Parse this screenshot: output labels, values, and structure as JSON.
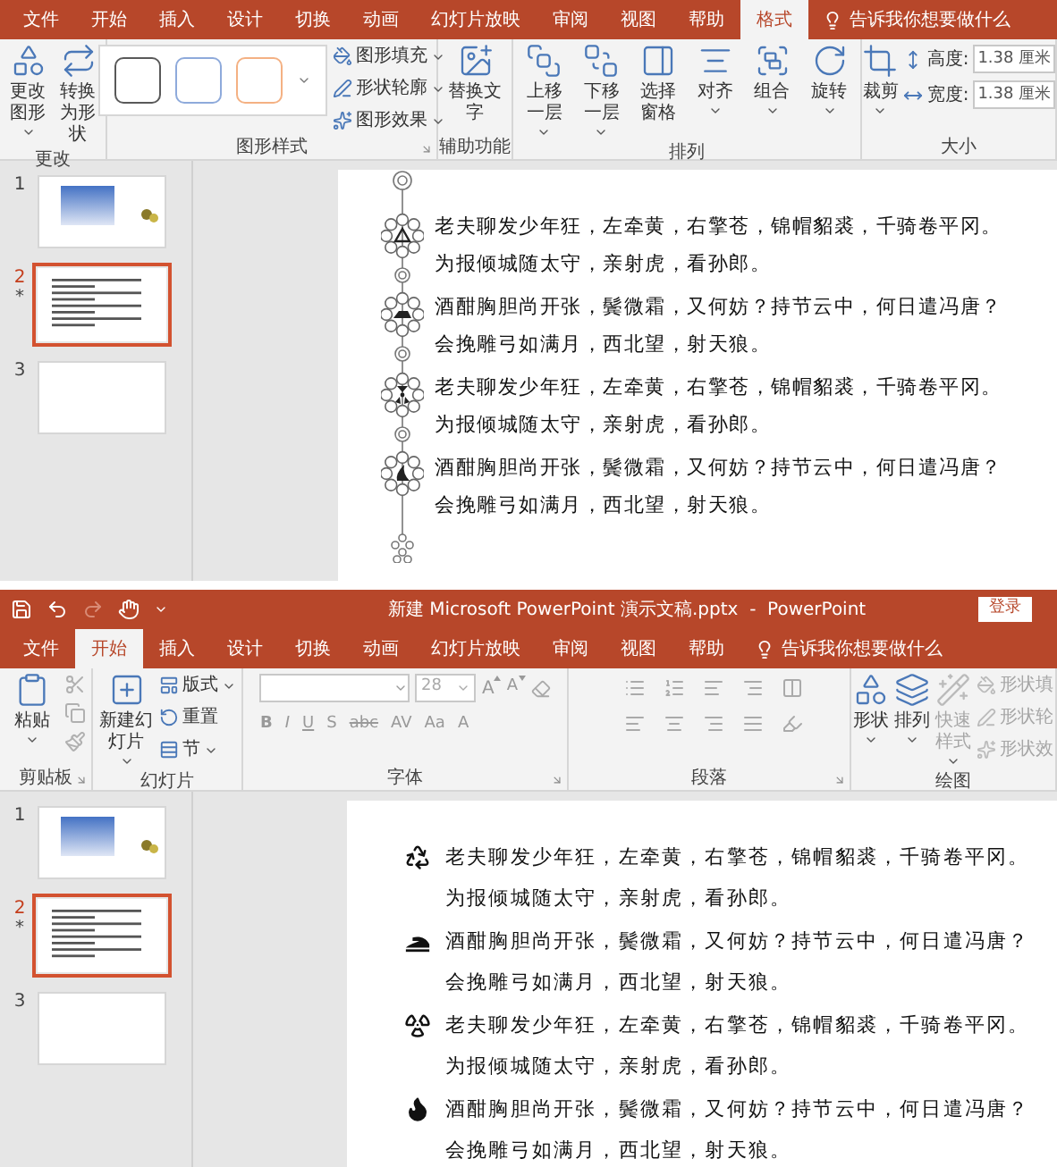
{
  "top_window": {
    "tabs": [
      {
        "label": "文件",
        "selected": false
      },
      {
        "label": "开始",
        "selected": false
      },
      {
        "label": "插入",
        "selected": false
      },
      {
        "label": "设计",
        "selected": false
      },
      {
        "label": "切换",
        "selected": false
      },
      {
        "label": "动画",
        "selected": false
      },
      {
        "label": "幻灯片放映",
        "selected": false
      },
      {
        "label": "审阅",
        "selected": false
      },
      {
        "label": "视图",
        "selected": false
      },
      {
        "label": "帮助",
        "selected": false
      },
      {
        "label": "格式",
        "selected": true
      }
    ],
    "tell_me": "告诉我你想要做什么",
    "ribbon": [
      {
        "label": "更改",
        "launcher": false,
        "items": [
          {
            "kind": "large",
            "label": "更改图形",
            "caret": true
          },
          {
            "kind": "large",
            "label": "转换为形状",
            "caret": false
          }
        ]
      },
      {
        "label": "图形样式",
        "launcher": true,
        "items": [
          {
            "kind": "swatches",
            "swatches": [
              {
                "color": "#595959"
              },
              {
                "color": "#8eaadb"
              },
              {
                "color": "#f4b183"
              }
            ]
          },
          {
            "kind": "stack",
            "entries": [
              {
                "label": "图形填充",
                "caret": true,
                "disabled": false
              },
              {
                "label": "形状轮廓",
                "caret": true,
                "disabled": false
              },
              {
                "label": "图形效果",
                "caret": true,
                "disabled": false
              }
            ]
          }
        ]
      },
      {
        "label": "辅助功能",
        "launcher": false,
        "items": [
          {
            "kind": "large",
            "label": "替换文字",
            "caret": false
          }
        ]
      },
      {
        "label": "排列",
        "launcher": false,
        "items": [
          {
            "kind": "large",
            "label": "上移一层",
            "caret": true
          },
          {
            "kind": "large",
            "label": "下移一层",
            "caret": true
          },
          {
            "kind": "large",
            "label": "选择窗格",
            "caret": false
          },
          {
            "kind": "large",
            "label": "对齐",
            "caret": true
          },
          {
            "kind": "large",
            "label": "组合",
            "caret": true
          },
          {
            "kind": "large",
            "label": "旋转",
            "caret": true
          }
        ]
      },
      {
        "label": "大小",
        "launcher": false,
        "items": [
          {
            "kind": "large",
            "label": "裁剪",
            "caret": true
          },
          {
            "kind": "fields",
            "entries": [
              {
                "label": "高度:",
                "value": "1.38 厘米"
              },
              {
                "label": "宽度:",
                "value": "1.38 厘米"
              }
            ]
          }
        ]
      }
    ],
    "thumbnails": [
      {
        "number": "1",
        "kind": "title",
        "selected": false
      },
      {
        "number": "2",
        "kind": "text",
        "selected": true,
        "mark": "*"
      },
      {
        "number": "3",
        "kind": "blank",
        "selected": false
      }
    ],
    "slide": {
      "paragraphs": [
        {
          "lines": [
            "老夫聊发少年狂，左牵黄，右擎苍，锦帽貂裘，千骑卷平冈。",
            "为报倾城随太守，亲射虎，看孙郎。"
          ]
        },
        {
          "lines": [
            "酒酣胸胆尚开张，鬓微霜，又何妨？持节云中，何日遣冯唐？",
            "会挽雕弓如满月，西北望，射天狼。"
          ]
        },
        {
          "lines": [
            "老夫聊发少年狂，左牵黄，右擎苍，锦帽貂裘，千骑卷平冈。",
            "为报倾城随太守，亲射虎，看孙郎。"
          ]
        },
        {
          "lines": [
            "酒酣胸胆尚开张，鬓微霜，又何妨？持节云中，何日遣冯唐？",
            "会挽雕弓如满月，西北望，射天狼。"
          ]
        }
      ]
    }
  },
  "bottom_window": {
    "quick_access": [
      {
        "disabled": false
      },
      {
        "disabled": false
      },
      {
        "disabled": true
      },
      {
        "disabled": false
      }
    ],
    "title": "新建 Microsoft PowerPoint 演示文稿.pptx  -  PowerPoint",
    "sign_in": "登录",
    "tabs": [
      {
        "label": "文件",
        "selected": false
      },
      {
        "label": "开始",
        "selected": true
      },
      {
        "label": "插入",
        "selected": false
      },
      {
        "label": "设计",
        "selected": false
      },
      {
        "label": "切换",
        "selected": false
      },
      {
        "label": "动画",
        "selected": false
      },
      {
        "label": "幻灯片放映",
        "selected": false
      },
      {
        "label": "审阅",
        "selected": false
      },
      {
        "label": "视图",
        "selected": false
      },
      {
        "label": "帮助",
        "selected": false
      }
    ],
    "tell_me": "告诉我你想要做什么",
    "ribbon": [
      {
        "label": "剪贴板",
        "launcher": true,
        "items": [
          {
            "kind": "large",
            "label": "粘贴",
            "caret": true
          },
          {
            "kind": "icons",
            "entries": [
              {
                "disabled": true
              },
              {
                "disabled": true
              },
              {
                "disabled": true
              }
            ]
          }
        ]
      },
      {
        "label": "幻灯片",
        "launcher": false,
        "items": [
          {
            "kind": "large",
            "label": "新建幻灯片",
            "caret": true
          },
          {
            "kind": "stack",
            "entries": [
              {
                "label": "版式",
                "caret": true,
                "disabled": false
              },
              {
                "label": "重置",
                "caret": false,
                "disabled": false
              },
              {
                "label": "节",
                "caret": true,
                "disabled": false
              }
            ]
          }
        ]
      },
      {
        "label": "字体",
        "launcher": true,
        "items": [
          {
            "kind": "font",
            "size": "28",
            "grow": "A",
            "shrink": "A",
            "buttons": [
              "B",
              "I",
              "U",
              "S",
              "abc",
              "AV",
              "Aa",
              "A"
            ]
          }
        ]
      },
      {
        "label": "段落",
        "launcher": true,
        "items": [
          {
            "kind": "paragraph"
          }
        ]
      },
      {
        "label": "绘图",
        "launcher": false,
        "items": [
          {
            "kind": "large",
            "label": "形状",
            "caret": true
          },
          {
            "kind": "large",
            "label": "排列",
            "caret": true
          },
          {
            "kind": "large",
            "label": "快速样式",
            "caret": true,
            "disabled": true
          },
          {
            "kind": "stack",
            "entries": [
              {
                "label": "形状填",
                "caret": false,
                "disabled": true
              },
              {
                "label": "形状轮",
                "caret": false,
                "disabled": true
              },
              {
                "label": "形状效",
                "caret": false,
                "disabled": true
              }
            ]
          }
        ]
      }
    ],
    "thumbnails": [
      {
        "number": "1",
        "kind": "title",
        "selected": false
      },
      {
        "number": "2",
        "kind": "text",
        "selected": true,
        "mark": "*"
      },
      {
        "number": "3",
        "kind": "blank",
        "selected": false
      }
    ],
    "slide": {
      "paragraphs": [
        {
          "lines": [
            "老夫聊发少年狂，左牵黄，右擎苍，锦帽貂裘，千骑卷平冈。",
            "为报倾城随太守，亲射虎，看孙郎。"
          ]
        },
        {
          "lines": [
            "酒酣胸胆尚开张，鬓微霜，又何妨？持节云中，何日遣冯唐？",
            "会挽雕弓如满月，西北望，射天狼。"
          ]
        },
        {
          "lines": [
            "老夫聊发少年狂，左牵黄，右擎苍，锦帽貂裘，千骑卷平冈。",
            "为报倾城随太守，亲射虎，看孙郎。"
          ]
        },
        {
          "lines": [
            "酒酣胸胆尚开张，鬓微霜，又何妨？持节云中，何日遣冯唐？",
            "会挽雕弓如满月，西北望，射天狼。"
          ]
        }
      ]
    }
  }
}
